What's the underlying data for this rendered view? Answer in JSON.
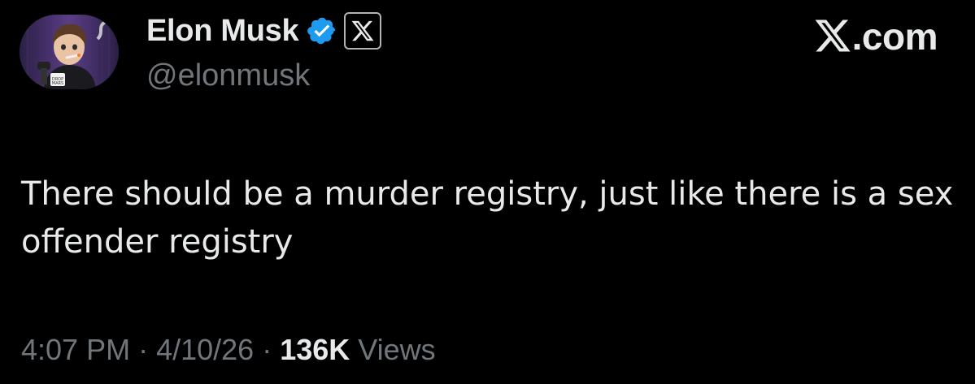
{
  "author": {
    "display_name": "Elon Musk",
    "handle": "@elonmusk",
    "verified_icon": "verified-check-icon",
    "affiliate_icon": "x-logo-icon",
    "avatar_icon": "cartoon-avatar"
  },
  "watermark": {
    "text": ".com",
    "icon": "x-logo-icon"
  },
  "tweet": {
    "text": "There should be a murder registry, just like there is a sex offender registry"
  },
  "meta": {
    "time": "4:07 PM",
    "separator": " · ",
    "date": "4/10/26",
    "views_count": "136K",
    "views_label": "Views"
  },
  "colors": {
    "background": "#000000",
    "primary_text": "#e7e9ea",
    "secondary_text": "#71767b",
    "verified_blue": "#1d9bf0"
  }
}
